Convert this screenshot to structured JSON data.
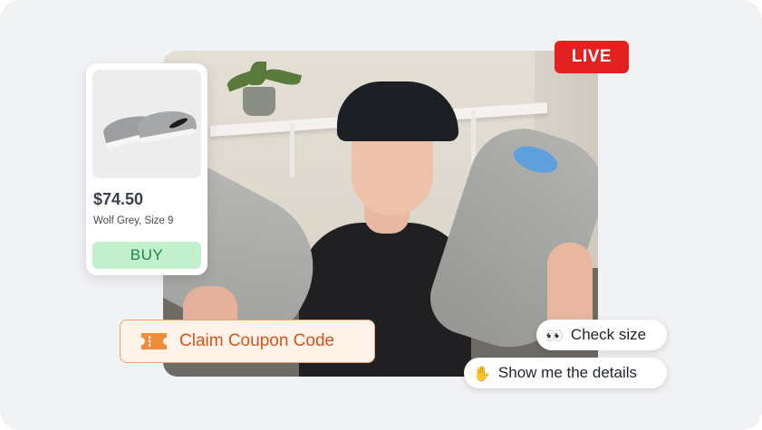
{
  "live_badge": {
    "label": "LIVE",
    "color": "#e3211f"
  },
  "product": {
    "price": "$74.50",
    "variant": "Wolf Grey, Size 9",
    "buy_label": "BUY",
    "buy_bg": "#c2f0cf",
    "buy_text_color": "#1f8a3f"
  },
  "coupon": {
    "icon": "ticket-icon",
    "label": "Claim Coupon Code",
    "accent": "#d2561b"
  },
  "chat_chips": [
    {
      "emoji": "👀",
      "icon": "eyes-icon",
      "label": "Check size"
    },
    {
      "emoji": "✋",
      "icon": "raised-hand-icon",
      "label": "Show me the details"
    }
  ]
}
